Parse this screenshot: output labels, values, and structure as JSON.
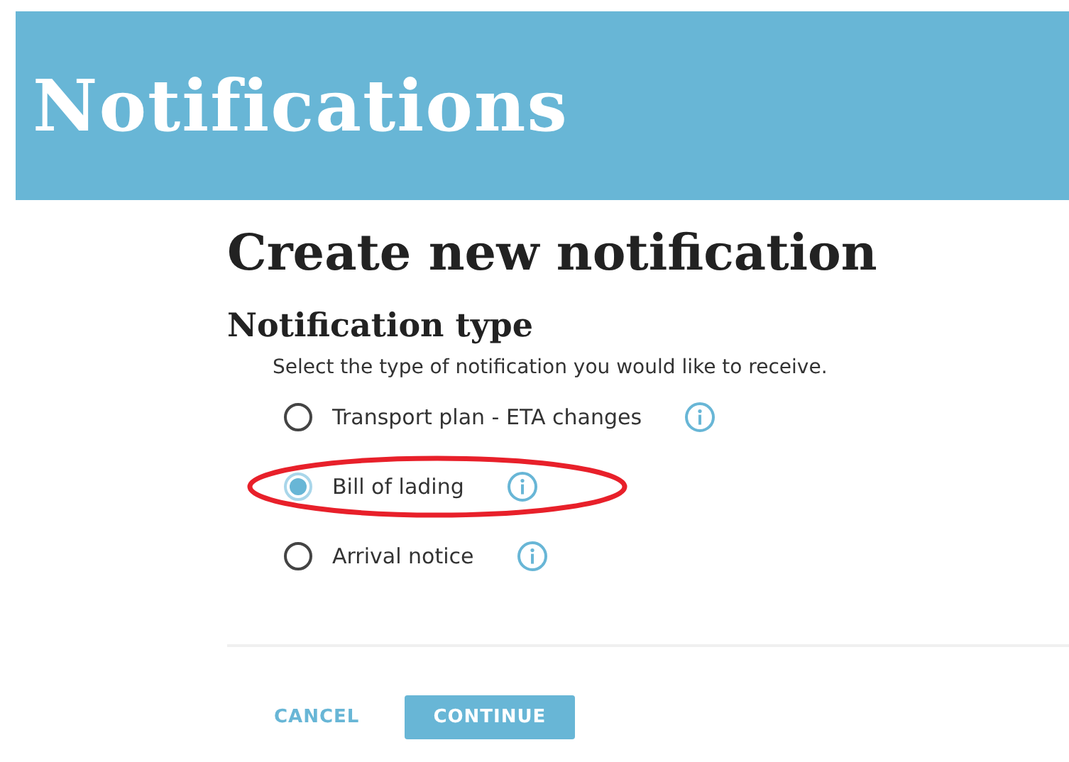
{
  "banner": {
    "title": "Notifications"
  },
  "heading": "Create new notification",
  "section": {
    "title": "Notification type",
    "description": "Select the type of notification you would like to receive."
  },
  "options": [
    {
      "label": "Transport plan - ETA changes",
      "selected": false,
      "highlighted": false
    },
    {
      "label": "Bill of lading",
      "selected": true,
      "highlighted": true
    },
    {
      "label": "Arrival notice",
      "selected": false,
      "highlighted": false
    }
  ],
  "buttons": [
    {
      "label": "CANCEL",
      "kind": "text"
    },
    {
      "label": "CONTINUE",
      "kind": "primary"
    }
  ]
}
